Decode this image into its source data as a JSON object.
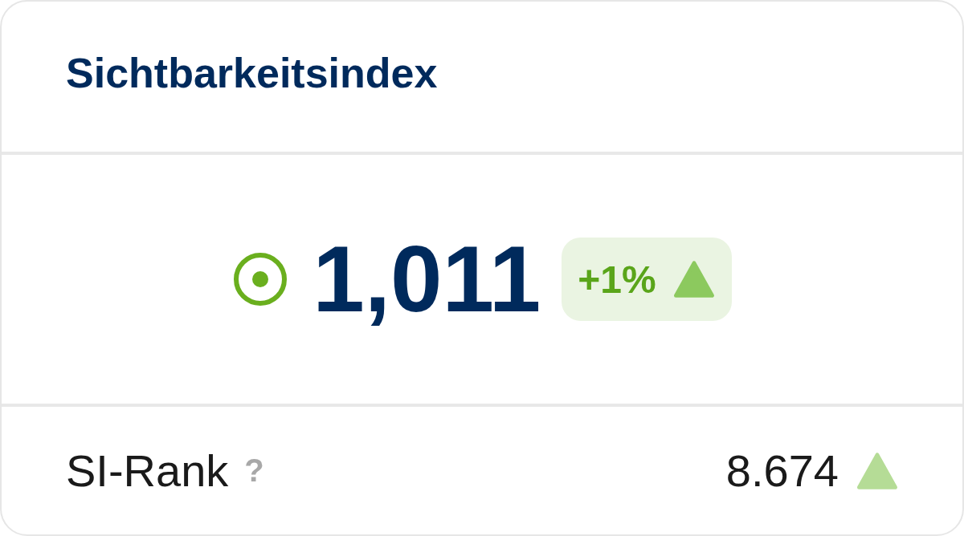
{
  "title": "Sichtbarkeitsindex",
  "kpi": {
    "value": "1,011",
    "change": "+1%",
    "rising": true
  },
  "rank": {
    "label": "SI-Rank",
    "help": "?",
    "value": "8.674",
    "rising": true
  }
}
